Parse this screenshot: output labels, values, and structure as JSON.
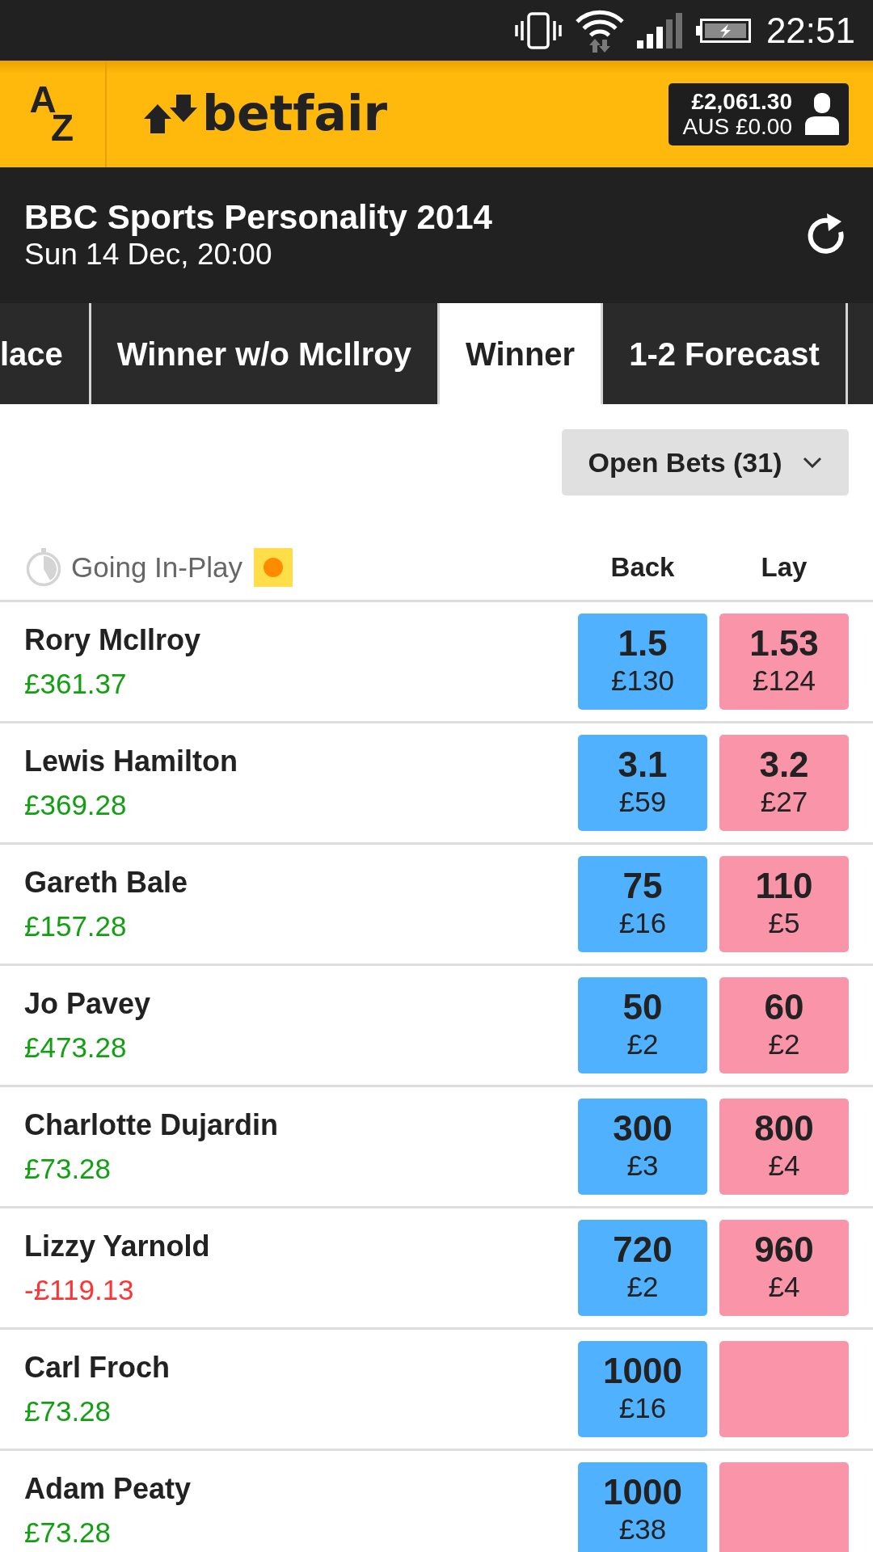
{
  "status_bar": {
    "time": "22:51"
  },
  "header": {
    "az_button": [
      "A",
      "Z"
    ],
    "logo_text": "betfair",
    "account": {
      "balance": "£2,061.30",
      "aus_balance": "AUS £0.00"
    }
  },
  "event": {
    "title": "BBC Sports Personality 2014",
    "date": "Sun 14 Dec, 20:00"
  },
  "tabs": [
    {
      "label": "lace",
      "selected": false
    },
    {
      "label": "Winner w/o McIlroy",
      "selected": false
    },
    {
      "label": "Winner",
      "selected": true
    },
    {
      "label": "1-2 Forecast",
      "selected": false
    }
  ],
  "open_bets_button": "Open Bets (31)",
  "market_header": {
    "going_in_play": "Going In-Play",
    "back": "Back",
    "lay": "Lay"
  },
  "runners": [
    {
      "name": "Rory McIlroy",
      "profit": "£361.37",
      "color": "#12a012",
      "back": {
        "odds": "1.5",
        "stake": "£130"
      },
      "lay": {
        "odds": "1.53",
        "stake": "£124"
      }
    },
    {
      "name": "Lewis Hamilton",
      "profit": "£369.28",
      "color": "#12a012",
      "back": {
        "odds": "3.1",
        "stake": "£59"
      },
      "lay": {
        "odds": "3.2",
        "stake": "£27"
      }
    },
    {
      "name": "Gareth Bale",
      "profit": "£157.28",
      "color": "#12a012",
      "back": {
        "odds": "75",
        "stake": "£16"
      },
      "lay": {
        "odds": "110",
        "stake": "£5"
      }
    },
    {
      "name": "Jo Pavey",
      "profit": "£473.28",
      "color": "#12a012",
      "back": {
        "odds": "50",
        "stake": "£2"
      },
      "lay": {
        "odds": "60",
        "stake": "£2"
      }
    },
    {
      "name": "Charlotte Dujardin",
      "profit": "£73.28",
      "color": "#12a012",
      "back": {
        "odds": "300",
        "stake": "£3"
      },
      "lay": {
        "odds": "800",
        "stake": "£4"
      }
    },
    {
      "name": "Lizzy Yarnold",
      "profit": "-£119.13",
      "color": "#ff3333",
      "back": {
        "odds": "720",
        "stake": "£2"
      },
      "lay": {
        "odds": "960",
        "stake": "£4"
      }
    },
    {
      "name": "Carl Froch",
      "profit": "£73.28",
      "color": "#12a012",
      "back": {
        "odds": "1000",
        "stake": "£16"
      }
    },
    {
      "name": "Adam Peaty",
      "profit": "£73.28",
      "color": "#12a012",
      "back": {
        "odds": "1000",
        "stake": "£38"
      }
    }
  ]
}
